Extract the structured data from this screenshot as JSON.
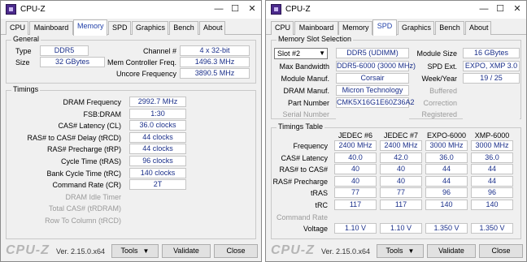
{
  "app": {
    "title": "CPU-Z",
    "brand": "CPU-Z",
    "version": "Ver. 2.15.0.x64",
    "minimize": "—",
    "maximize": "☐",
    "close": "✕"
  },
  "tabs": [
    "CPU",
    "Mainboard",
    "Memory",
    "SPD",
    "Graphics",
    "Bench",
    "About"
  ],
  "buttons": {
    "tools": "Tools",
    "validate": "Validate",
    "close": "Close",
    "arrow": "▼"
  },
  "memory": {
    "general_title": "General",
    "type_label": "Type",
    "type": "DDR5",
    "size_label": "Size",
    "size": "32 GBytes",
    "channel_label": "Channel #",
    "channel": "4 x 32-bit",
    "mem_ctrl_label": "Mem Controller Freq.",
    "mem_ctrl": "1496.3 MHz",
    "uncore_label": "Uncore Frequency",
    "uncore": "3890.5 MHz",
    "timings_title": "Timings",
    "timings": [
      {
        "label": "DRAM Frequency",
        "value": "2992.7 MHz",
        "dim": false
      },
      {
        "label": "FSB:DRAM",
        "value": "1:30",
        "dim": false
      },
      {
        "label": "CAS# Latency (CL)",
        "value": "36.0 clocks",
        "dim": false
      },
      {
        "label": "RAS# to CAS# Delay (tRCD)",
        "value": "44 clocks",
        "dim": false
      },
      {
        "label": "RAS# Precharge (tRP)",
        "value": "44 clocks",
        "dim": false
      },
      {
        "label": "Cycle Time (tRAS)",
        "value": "96 clocks",
        "dim": false
      },
      {
        "label": "Bank Cycle Time (tRC)",
        "value": "140 clocks",
        "dim": false
      },
      {
        "label": "Command Rate (CR)",
        "value": "2T",
        "dim": false
      },
      {
        "label": "DRAM Idle Timer",
        "value": "",
        "dim": true
      },
      {
        "label": "Total CAS# (tRDRAM)",
        "value": "",
        "dim": true
      },
      {
        "label": "Row To Column (tRCD)",
        "value": "",
        "dim": true
      }
    ]
  },
  "spd": {
    "slot_title": "Memory Slot Selection",
    "slot": "Slot #2",
    "module_type": "DDR5 (UDIMM)",
    "module_size_label": "Module Size",
    "module_size": "16 GBytes",
    "max_bw_label": "Max Bandwidth",
    "max_bw": "DDR5-6000 (3000 MHz)",
    "spd_ext_label": "SPD Ext.",
    "spd_ext": "EXPO, XMP 3.0",
    "module_manuf_label": "Module Manuf.",
    "module_manuf": "Corsair",
    "week_year_label": "Week/Year",
    "week_year": "19 / 25",
    "dram_manuf_label": "DRAM Manuf.",
    "dram_manuf": "Micron Technology",
    "buffered_label": "Buffered",
    "part_label": "Part Number",
    "part": "CMK5X16G1E60Z36A2",
    "correction_label": "Correction",
    "serial_label": "Serial Number",
    "registered_label": "Registered",
    "timings_title": "Timings Table",
    "columns": [
      "JEDEC #6",
      "JEDEC #7",
      "EXPO-6000",
      "XMP-6000"
    ],
    "rows": [
      {
        "label": "Frequency",
        "values": [
          "2400 MHz",
          "2400 MHz",
          "3000 MHz",
          "3000 MHz"
        ],
        "dim": false
      },
      {
        "label": "CAS# Latency",
        "values": [
          "40.0",
          "42.0",
          "36.0",
          "36.0"
        ],
        "dim": false
      },
      {
        "label": "RAS# to CAS#",
        "values": [
          "40",
          "40",
          "44",
          "44"
        ],
        "dim": false
      },
      {
        "label": "RAS# Precharge",
        "values": [
          "40",
          "40",
          "44",
          "44"
        ],
        "dim": false
      },
      {
        "label": "tRAS",
        "values": [
          "77",
          "77",
          "96",
          "96"
        ],
        "dim": false
      },
      {
        "label": "tRC",
        "values": [
          "117",
          "117",
          "140",
          "140"
        ],
        "dim": false
      },
      {
        "label": "Command Rate",
        "values": [
          "",
          "",
          "",
          ""
        ],
        "dim": true
      },
      {
        "label": "Voltage",
        "values": [
          "1.10 V",
          "1.10 V",
          "1.350 V",
          "1.350 V"
        ],
        "dim": false
      }
    ]
  }
}
